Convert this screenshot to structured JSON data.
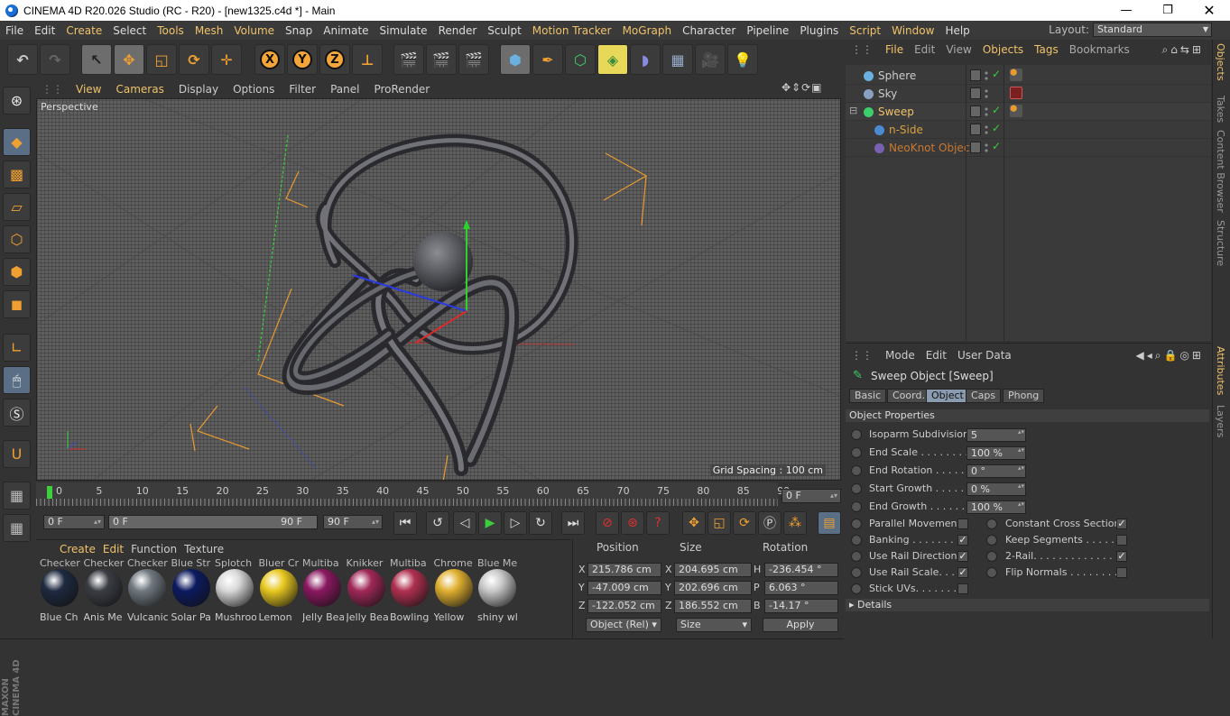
{
  "window": {
    "title": "CINEMA 4D R20.026 Studio (RC - R20) - [new1325.c4d *] - Main"
  },
  "menu": [
    "File",
    "Edit",
    "Create",
    "Select",
    "Tools",
    "Mesh",
    "Volume",
    "Snap",
    "Animate",
    "Simulate",
    "Render",
    "Sculpt",
    "Motion Tracker",
    "MoGraph",
    "Character",
    "Pipeline",
    "Plugins",
    "Script",
    "Window",
    "Help"
  ],
  "layout": {
    "label": "Layout:",
    "value": "Standard"
  },
  "viewport": {
    "menu": [
      "View",
      "Cameras",
      "Display",
      "Options",
      "Filter",
      "Panel",
      "ProRender"
    ],
    "label": "Perspective",
    "grid_spacing": "Grid Spacing : 100 cm"
  },
  "timeline": {
    "ticks": [
      "0",
      "5",
      "10",
      "15",
      "20",
      "25",
      "30",
      "35",
      "40",
      "45",
      "50",
      "55",
      "60",
      "65",
      "70",
      "75",
      "80",
      "85",
      "90"
    ],
    "current_frame": "0 F",
    "start": "0 F",
    "range_start": "0 F",
    "range_end": "90 F",
    "end": "90 F"
  },
  "materials": {
    "menu": [
      "Create",
      "Edit",
      "Function",
      "Texture"
    ],
    "top_row": [
      "Checker",
      "Checker",
      "Checker",
      "Blue Str",
      "Splotch",
      "Bluer Cr",
      "Multiba",
      "Knikker",
      "Multiba",
      "Chrome",
      "Blue Me"
    ],
    "items": [
      {
        "name": "Blue Ch",
        "color": "#1e2a40"
      },
      {
        "name": "Anis Me",
        "color": "#3a3d44"
      },
      {
        "name": "Vulcanic",
        "color": "#707880"
      },
      {
        "name": "Solar Pa",
        "color": "#0c1a60"
      },
      {
        "name": "Mushroo",
        "color": "#d8d8d8"
      },
      {
        "name": "Lemon",
        "color": "#e8c820"
      },
      {
        "name": "Jelly Bea",
        "color": "#8a1860"
      },
      {
        "name": "Jelly Bea",
        "color": "#a02858"
      },
      {
        "name": "Bowling",
        "color": "#b03050"
      },
      {
        "name": "Yellow",
        "color": "#e0b030"
      },
      {
        "name": "shiny wl",
        "color": "#c8c8c8"
      }
    ]
  },
  "coordinates": {
    "headers": [
      "Position",
      "Size",
      "Rotation"
    ],
    "rows": [
      {
        "axis": "X",
        "pos": "215.786 cm",
        "saxis": "X",
        "size": "204.695 cm",
        "raxis": "H",
        "rot": "-236.454 °"
      },
      {
        "axis": "Y",
        "pos": "-47.009 cm",
        "saxis": "Y",
        "size": "202.696 cm",
        "raxis": "P",
        "rot": "6.063 °"
      },
      {
        "axis": "Z",
        "pos": "-122.052 cm",
        "saxis": "Z",
        "size": "186.552 cm",
        "raxis": "B",
        "rot": "-14.17 °"
      }
    ],
    "mode": "Object (Rel)",
    "size_mode": "Size",
    "apply": "Apply"
  },
  "objects": {
    "menu": [
      "File",
      "Edit",
      "View",
      "Objects",
      "Tags",
      "Bookmarks"
    ],
    "rows": [
      {
        "name": "Sphere",
        "color": "#ccc",
        "icon_color": "#6ab0e0"
      },
      {
        "name": "Sky",
        "color": "#ccc",
        "icon_color": "#8aa0c0"
      },
      {
        "name": "Sweep",
        "color": "#f0c36a",
        "icon_color": "#3ccf6a"
      },
      {
        "name": "n-Side",
        "color": "#d8a040",
        "icon_color": "#4a8ad0"
      },
      {
        "name": "NeoKnot Object",
        "color": "#c87830",
        "icon_color": "#7a60b0"
      }
    ]
  },
  "side_tabs": [
    "Objects",
    "Takes",
    "Content Browser",
    "Structure",
    "Attributes",
    "Layers"
  ],
  "attributes": {
    "menu": [
      "Mode",
      "Edit",
      "User Data"
    ],
    "title": "Sweep Object [Sweep]",
    "tabs": [
      "Basic",
      "Coord.",
      "Object",
      "Caps",
      "Phong"
    ],
    "section": "Object Properties",
    "fields": [
      {
        "label": "Isoparm Subdivision",
        "value": "5"
      },
      {
        "label": "End Scale . . . . . . . . .",
        "value": "100 %"
      },
      {
        "label": "End Rotation . . . . . .",
        "value": "0 °"
      },
      {
        "label": "Start Growth . . . . . .",
        "value": "0 %"
      },
      {
        "label": "End Growth . . . . . . .",
        "value": "100 %"
      }
    ],
    "left_checks": [
      {
        "label": "Parallel Movement",
        "checked": false
      },
      {
        "label": "Banking . . . . . . . . .",
        "checked": true
      },
      {
        "label": "Use Rail Direction",
        "checked": true
      },
      {
        "label": "Use Rail Scale. . . .",
        "checked": true
      },
      {
        "label": "Stick UVs. . . . . . . .",
        "checked": false
      }
    ],
    "right_checks": [
      {
        "label": "Constant Cross Section",
        "checked": true
      },
      {
        "label": "Keep Segments . . . . . .",
        "checked": false
      },
      {
        "label": "2-Rail. . . . . . . . . . . . . .",
        "checked": true
      },
      {
        "label": "Flip Normals . . . . . . . . .",
        "checked": false
      }
    ],
    "details": "Details"
  }
}
